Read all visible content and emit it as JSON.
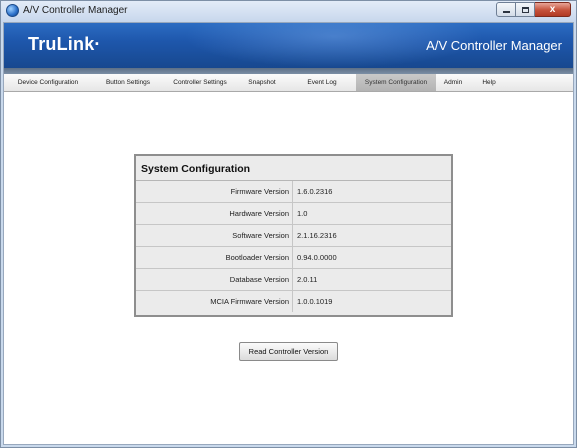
{
  "window": {
    "title": "A/V Controller Manager",
    "icon": "app-globe-icon",
    "controls": {
      "minimize": "minimize-icon",
      "maximize": "maximize-icon",
      "close_glyph": "x"
    }
  },
  "banner": {
    "logo": "TruLink·",
    "title": "A/V Controller Manager",
    "colors": {
      "banner": "#1e57ac",
      "strip": "#6a7d94"
    }
  },
  "menu": {
    "items": [
      {
        "label": "Device Configuration"
      },
      {
        "label": "Button Settings"
      },
      {
        "label": "Controller Settings"
      },
      {
        "label": "Snapshot"
      },
      {
        "label": "Event Log"
      },
      {
        "label": "System Configuration",
        "active": true
      },
      {
        "label": "Admin"
      },
      {
        "label": "Help"
      }
    ]
  },
  "system_config": {
    "title": "System Configuration",
    "rows": [
      {
        "label": "Firmware Version",
        "value": "1.6.0.2316"
      },
      {
        "label": "Hardware Version",
        "value": "1.0"
      },
      {
        "label": "Software Version",
        "value": "2.1.16.2316"
      },
      {
        "label": "Bootloader Version",
        "value": "0.94.0.0000"
      },
      {
        "label": "Database Version",
        "value": "2.0.11"
      },
      {
        "label": "MCIA Firmware Version",
        "value": "1.0.0.1019"
      }
    ]
  },
  "actions": {
    "read_label": "Read Controller Version"
  }
}
